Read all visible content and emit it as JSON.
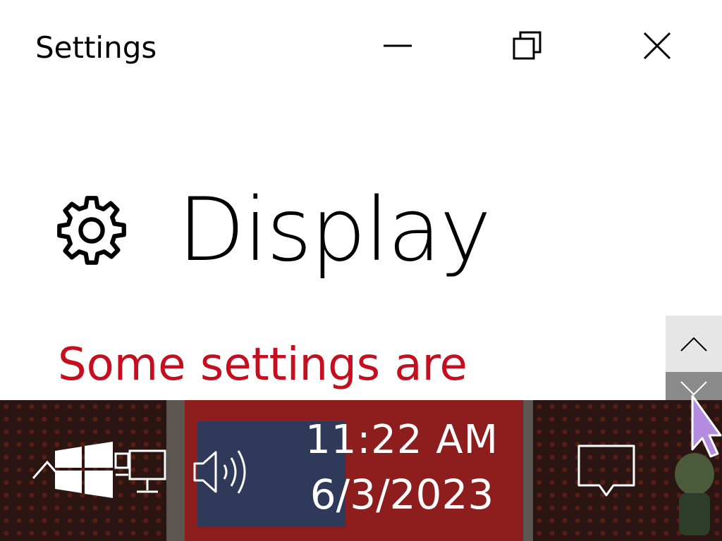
{
  "window": {
    "title": "Settings",
    "minimize_icon": "minimize-icon",
    "restore_icon": "restore-icon",
    "close_icon": "close-icon"
  },
  "page": {
    "icon": "gear-icon",
    "title": "Display",
    "warning": "Some settings are"
  },
  "scrollbar": {
    "up_icon": "chevron-up-icon",
    "down_icon": "chevron-down-icon"
  },
  "taskbar": {
    "time": "11:22 AM",
    "date": "6/3/2023",
    "icons": [
      "chevron-up-icon",
      "windows-logo-icon",
      "network-icon",
      "speaker-icon",
      "notification-icon"
    ]
  },
  "colors": {
    "warning": "#c50f1f",
    "taskbar_text": "#ffffff",
    "scroll_up_bg": "#e6e6e6",
    "scroll_down_bg": "#8a8a8a",
    "cursor": "#b48ce0"
  }
}
